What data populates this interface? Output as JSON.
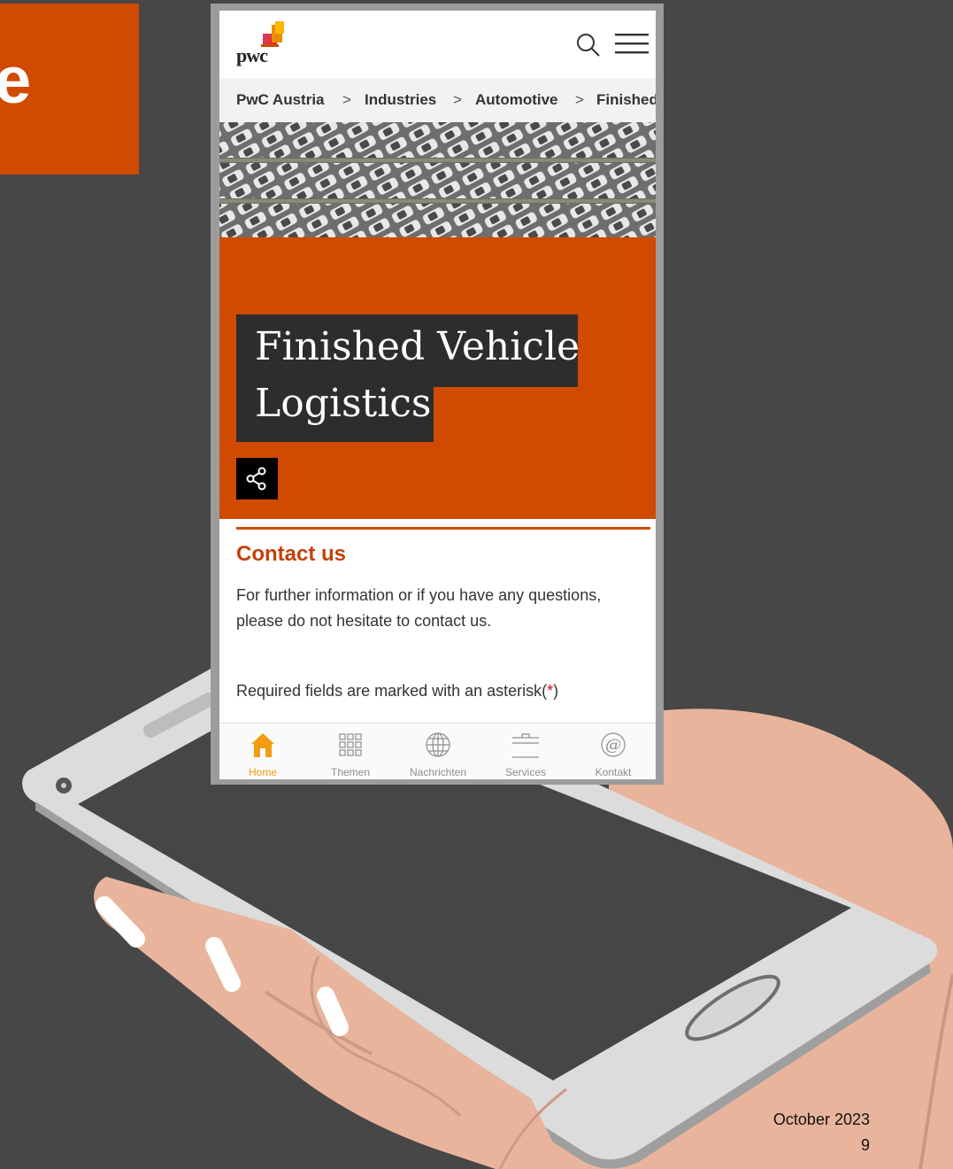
{
  "slide": {
    "tag_text": "e",
    "date": "October 2023",
    "page_number": "9"
  },
  "app": {
    "logo": "pwc",
    "breadcrumbs": [
      "PwC Austria",
      "Industries",
      "Automotive",
      "Finished"
    ],
    "breadcrumb_separator": ">",
    "hero": {
      "title_line1": "Finished Vehicle",
      "title_line2": "Logistics"
    },
    "contact": {
      "title": "Contact us",
      "body": "For further information or if you have any questions, please do not hesitate to contact us.",
      "required_prefix": "Required fields are marked with an asterisk(",
      "required_asterisk": "*",
      "required_suffix": ")"
    },
    "tabs": [
      {
        "label": "Home",
        "icon": "home-icon"
      },
      {
        "label": "Themen",
        "icon": "grid-icon"
      },
      {
        "label": "Nachrichten",
        "icon": "globe-icon"
      },
      {
        "label": "Services",
        "icon": "briefcase-icon"
      },
      {
        "label": "Kontakt",
        "icon": "at-icon"
      }
    ]
  },
  "colors": {
    "accent": "#d04a02",
    "background": "#474747",
    "tab_active": "#f39c12"
  }
}
